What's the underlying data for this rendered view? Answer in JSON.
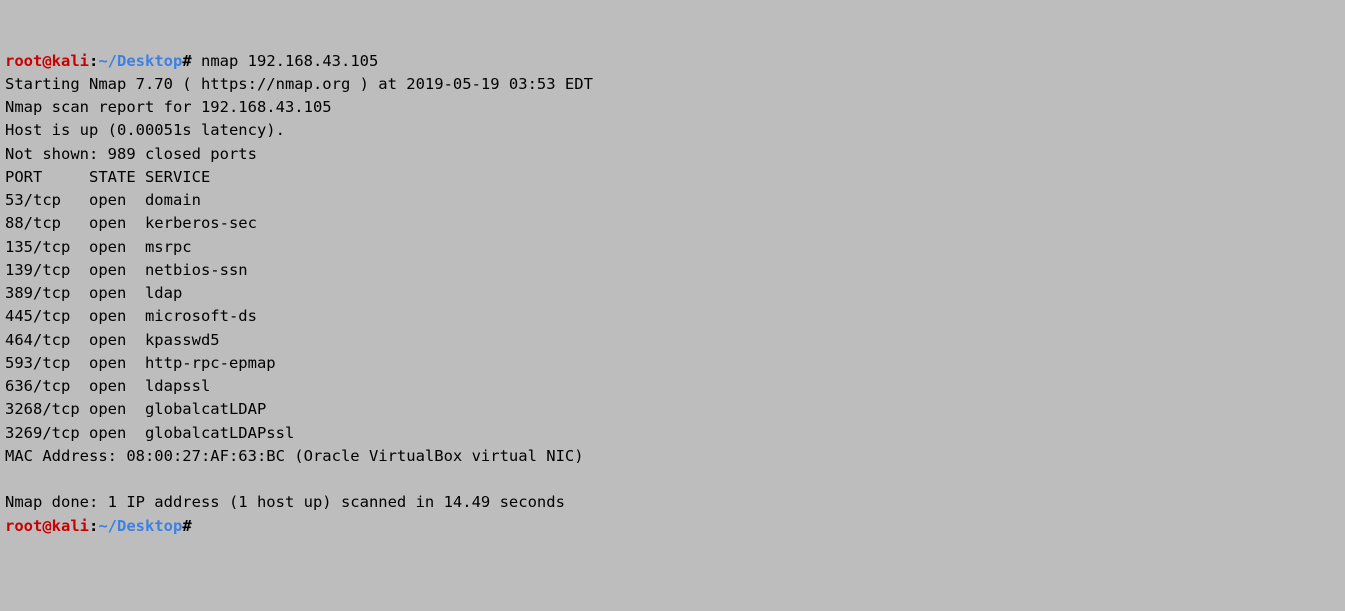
{
  "p1": {
    "user": "root@kali",
    "colon": ":",
    "path": "~/Desktop",
    "hash": "#",
    "cmd": " nmap 192.168.43.105"
  },
  "out": {
    "l1": "Starting Nmap 7.70 ( https://nmap.org ) at 2019-05-19 03:53 EDT",
    "l2": "Nmap scan report for 192.168.43.105",
    "l3": "Host is up (0.00051s latency).",
    "l4": "Not shown: 989 closed ports",
    "l5": "PORT     STATE SERVICE",
    "l6": "53/tcp   open  domain",
    "l7": "88/tcp   open  kerberos-sec",
    "l8": "135/tcp  open  msrpc",
    "l9": "139/tcp  open  netbios-ssn",
    "l10": "389/tcp  open  ldap",
    "l11": "445/tcp  open  microsoft-ds",
    "l12": "464/tcp  open  kpasswd5",
    "l13": "593/tcp  open  http-rpc-epmap",
    "l14": "636/tcp  open  ldapssl",
    "l15": "3268/tcp open  globalcatLDAP",
    "l16": "3269/tcp open  globalcatLDAPssl",
    "l17": "MAC Address: 08:00:27:AF:63:BC (Oracle VirtualBox virtual NIC)",
    "l18": "",
    "l19": "Nmap done: 1 IP address (1 host up) scanned in 14.49 seconds"
  },
  "p2": {
    "user": "root@kali",
    "colon": ":",
    "path": "~/Desktop",
    "hash": "#"
  }
}
